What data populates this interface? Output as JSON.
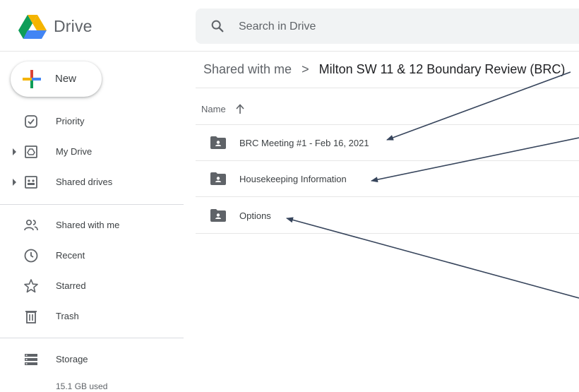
{
  "app": {
    "name": "Drive"
  },
  "search": {
    "placeholder": "Search in Drive"
  },
  "sidebar": {
    "new_label": "New",
    "items": [
      {
        "label": "Priority",
        "icon": "priority-icon"
      },
      {
        "label": "My Drive",
        "icon": "my-drive-icon",
        "expandable": true
      },
      {
        "label": "Shared drives",
        "icon": "shared-drives-icon",
        "expandable": true
      },
      {
        "label": "Shared with me",
        "icon": "people-icon"
      },
      {
        "label": "Recent",
        "icon": "clock-icon"
      },
      {
        "label": "Starred",
        "icon": "star-icon"
      },
      {
        "label": "Trash",
        "icon": "trash-icon"
      },
      {
        "label": "Storage",
        "icon": "storage-icon"
      }
    ],
    "storage_used": "15.1 GB used"
  },
  "breadcrumb": {
    "parent": "Shared with me",
    "separator": ">",
    "current": "Milton SW 11 & 12 Boundary Review (BRC)"
  },
  "list": {
    "column_name": "Name",
    "sort": "ascending",
    "rows": [
      {
        "label": "BRC Meeting #1 - Feb 16, 2021",
        "icon": "shared-folder-icon"
      },
      {
        "label": "Housekeeping Information",
        "icon": "shared-folder-icon"
      },
      {
        "label": "Options",
        "icon": "shared-folder-icon"
      }
    ]
  },
  "colors": {
    "text": "#3c4043",
    "muted": "#5f6368",
    "search_bg": "#f1f3f4",
    "annotation_arrow": "#37455c",
    "drive_green": "#0f9d58",
    "drive_yellow": "#f4b400",
    "drive_blue": "#4285f4",
    "drive_red": "#db4437"
  }
}
